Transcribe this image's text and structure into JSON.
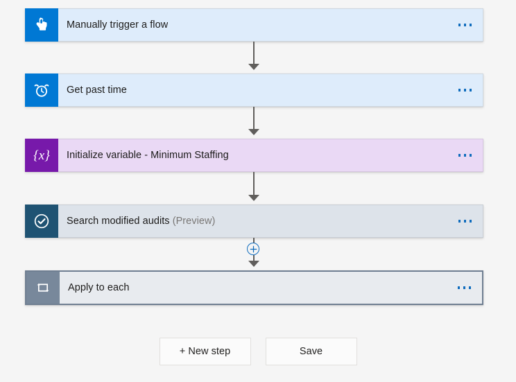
{
  "canvas": {
    "background_color": "#f5f5f5"
  },
  "flow": {
    "steps": [
      {
        "id": "manually-trigger-a-flow",
        "title": "Manually trigger a flow",
        "suffix": "",
        "icon_name": "tap-hand-icon",
        "icon_bg": "#0078d4",
        "body_bg": "#deecfb",
        "selected": false,
        "menu_label": "..."
      },
      {
        "id": "get-past-time",
        "title": "Get past time",
        "suffix": "",
        "icon_name": "alarm-clock-icon",
        "icon_bg": "#0078d4",
        "body_bg": "#deecfb",
        "selected": false,
        "menu_label": "..."
      },
      {
        "id": "initialize-variable-minimum-staffing",
        "title": "Initialize variable - Minimum Staffing",
        "suffix": "",
        "icon_name": "variable-braces-icon",
        "icon_bg": "#7719aa",
        "body_bg": "#ead9f5",
        "selected": false,
        "menu_label": "..."
      },
      {
        "id": "search-modified-audits",
        "title": "Search modified audits",
        "suffix": "(Preview)",
        "icon_name": "check-circle-icon",
        "icon_bg": "#1f5373",
        "body_bg": "#dde3ea",
        "selected": false,
        "menu_label": "..."
      },
      {
        "id": "apply-to-each",
        "title": "Apply to each",
        "suffix": "",
        "icon_name": "loop-repeat-icon",
        "icon_bg": "#78889b",
        "body_bg": "#e8ebef",
        "selected": true,
        "menu_label": "..."
      }
    ],
    "insert_button": {
      "icon_name": "plus-icon",
      "color": "#0f6cbd"
    },
    "connector_color": "#605e5c"
  },
  "actions": {
    "new_step_label": "+ New step",
    "save_label": "Save"
  },
  "colors": {
    "accent_blue": "#0078d4",
    "link_blue": "#0f6cbd",
    "variable_purple": "#7719aa",
    "audit_teal": "#1f5373",
    "loop_gray": "#78889b",
    "preview_text": "#797775"
  }
}
